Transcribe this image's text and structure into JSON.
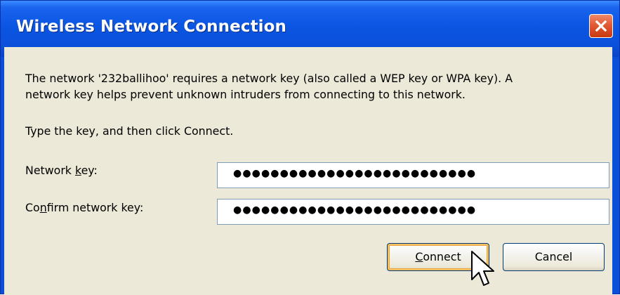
{
  "window": {
    "title": "Wireless Network Connection",
    "close_icon": "close-icon",
    "accent_color": "#0a55e2",
    "close_color": "#e25a34"
  },
  "message": {
    "line1": "The network '232ballihoo' requires a network key (also called a WEP key or WPA key). A",
    "line2": "network key helps prevent unknown intruders from connecting to this network."
  },
  "instruction": "Type the key, and then click Connect.",
  "form": {
    "network_key": {
      "label_pre": "Network ",
      "label_accel": "k",
      "label_post": "ey:",
      "value": "●●●●●●●●●●●●●●●●●●●●●●●●●●"
    },
    "confirm_key": {
      "label_pre": "Co",
      "label_accel": "n",
      "label_post": "firm network key:",
      "value": "●●●●●●●●●●●●●●●●●●●●●●●●●●"
    }
  },
  "buttons": {
    "connect_accel": "C",
    "connect_rest": "onnect",
    "cancel": "Cancel"
  },
  "cursor_icon": "arrow-cursor-icon"
}
